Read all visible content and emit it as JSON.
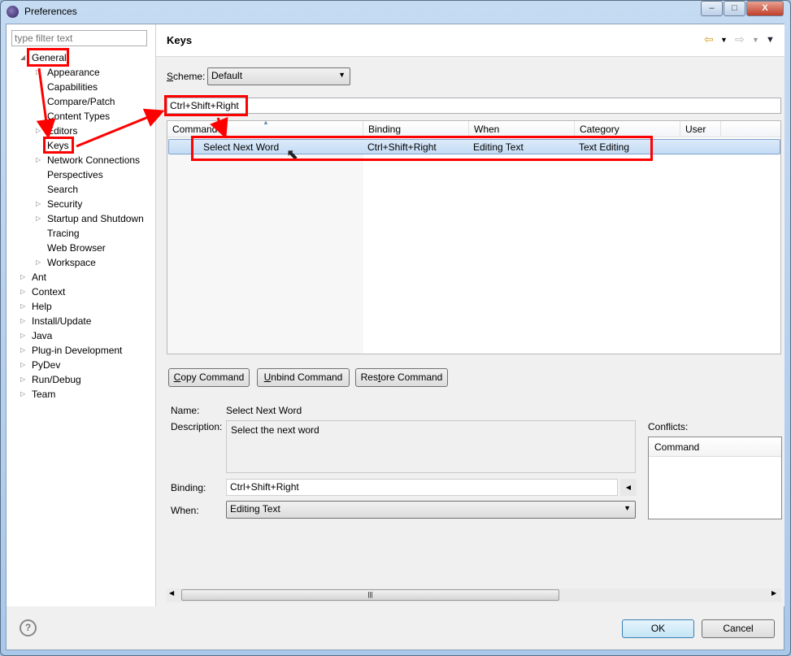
{
  "window": {
    "title": "Preferences",
    "minimize": "–",
    "maximize": "□",
    "close": "X"
  },
  "sidebar": {
    "filter_placeholder": "type filter text",
    "items": [
      {
        "label": "General",
        "expanded": true
      },
      {
        "label": "Appearance",
        "expandable": true
      },
      {
        "label": "Capabilities"
      },
      {
        "label": "Compare/Patch"
      },
      {
        "label": "Content Types"
      },
      {
        "label": "Editors",
        "expandable": true
      },
      {
        "label": "Keys"
      },
      {
        "label": "Network Connections",
        "expandable": true
      },
      {
        "label": "Perspectives"
      },
      {
        "label": "Search"
      },
      {
        "label": "Security",
        "expandable": true
      },
      {
        "label": "Startup and Shutdown",
        "expandable": true
      },
      {
        "label": "Tracing"
      },
      {
        "label": "Web Browser"
      },
      {
        "label": "Workspace",
        "expandable": true
      },
      {
        "label": "Ant",
        "expandable": true
      },
      {
        "label": "Context",
        "expandable": true
      },
      {
        "label": "Help",
        "expandable": true
      },
      {
        "label": "Install/Update",
        "expandable": true
      },
      {
        "label": "Java",
        "expandable": true
      },
      {
        "label": "Plug-in Development",
        "expandable": true
      },
      {
        "label": "PyDev",
        "expandable": true
      },
      {
        "label": "Run/Debug",
        "expandable": true
      },
      {
        "label": "Team",
        "expandable": true
      }
    ]
  },
  "page": {
    "title": "Keys",
    "scheme_label_s": "S",
    "scheme_label_rest": "cheme:",
    "scheme_value": "Default",
    "search_value": "Ctrl+Shift+Right",
    "table": {
      "headers": [
        "Command",
        "Binding",
        "When",
        "Category",
        "User"
      ],
      "rows": [
        {
          "command": "Select Next Word",
          "binding": "Ctrl+Shift+Right",
          "when": "Editing Text",
          "category": "Text Editing",
          "user": ""
        }
      ]
    },
    "buttons": {
      "copy_u": "C",
      "copy_rest": "opy Command",
      "unbind_u": "U",
      "unbind_rest": "nbind Command",
      "restore_a": "Res",
      "restore_u": "t",
      "restore_b": "ore Command"
    },
    "details": {
      "name_label": "Name:",
      "name_value": "Select Next Word",
      "description_label": "Description:",
      "description_value": "Select the next word",
      "binding_label": "Binding:",
      "binding_value": "Ctrl+Shift+Right",
      "when_label": "When:",
      "when_value": "Editing Text",
      "conflicts_label": "Conflicts:",
      "conflicts_header": "Command"
    }
  },
  "footer": {
    "help": "?",
    "ok": "OK",
    "cancel": "Cancel"
  },
  "annotation_color": "#ff0000"
}
